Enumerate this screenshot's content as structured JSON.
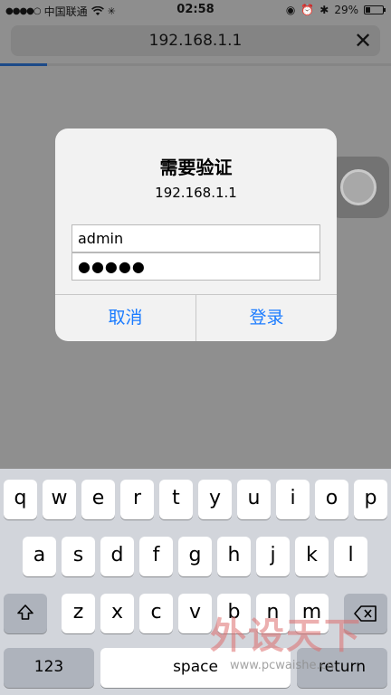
{
  "status_bar": {
    "carrier": "中国联通",
    "time": "02:58",
    "battery": "29%",
    "battery_level": 0.29
  },
  "browser": {
    "address": "192.168.1.1",
    "progress": 0.12
  },
  "dialog": {
    "title": "需要验证",
    "message": "192.168.1.1",
    "username_value": "admin",
    "password_masked": "●●●●●",
    "cancel_label": "取消",
    "login_label": "登录"
  },
  "keyboard": {
    "row1": [
      "q",
      "w",
      "e",
      "r",
      "t",
      "y",
      "u",
      "i",
      "o",
      "p"
    ],
    "row2": [
      "a",
      "s",
      "d",
      "f",
      "g",
      "h",
      "j",
      "k",
      "l"
    ],
    "row3": [
      "z",
      "x",
      "c",
      "v",
      "b",
      "n",
      "m"
    ],
    "shift_icon": "shift-icon",
    "delete_icon": "delete-icon",
    "numbers_label": "123",
    "space_label": "space",
    "return_label": "return"
  },
  "watermark": {
    "brand": "外设天下",
    "url": "www.pcwaishe.cn"
  }
}
